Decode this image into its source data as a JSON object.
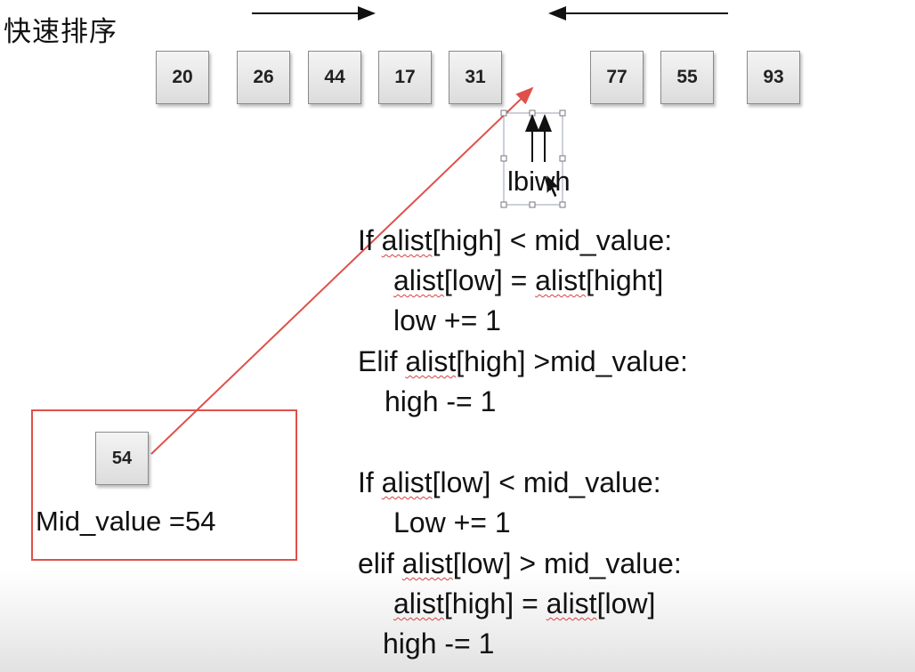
{
  "title": "快速排序",
  "boxes": [
    "20",
    "26",
    "44",
    "17",
    "31",
    "77",
    "55",
    "93"
  ],
  "pointer_label": "lbiwh",
  "mid_box": "54",
  "mid_label": "Mid_value =54",
  "code": {
    "l1a": "If ",
    "l1b": "alist",
    "l1c": "[high] < mid_value:",
    "l2a": "alist",
    "l2b": "[low] = ",
    "l2c": "alist",
    "l2d": "[hight]",
    "l3": "low += 1",
    "l4a": "Elif ",
    "l4b": "alist",
    "l4c": "[high] >mid_value:",
    "l5": "high -= 1",
    "l6a": "If ",
    "l6b": "alist",
    "l6c": "[low] < mid_value:",
    "l7": "Low += 1",
    "l8a": "elif ",
    "l8b": "alist",
    "l8c": "[low] > mid_value:",
    "l9a": "alist",
    "l9b": "[high] = ",
    "l9c": "alist",
    "l9d": "[low]",
    "l10": "high -= 1"
  },
  "colors": {
    "annotation_red": "#e0504a",
    "squiggle": "#d94040"
  }
}
